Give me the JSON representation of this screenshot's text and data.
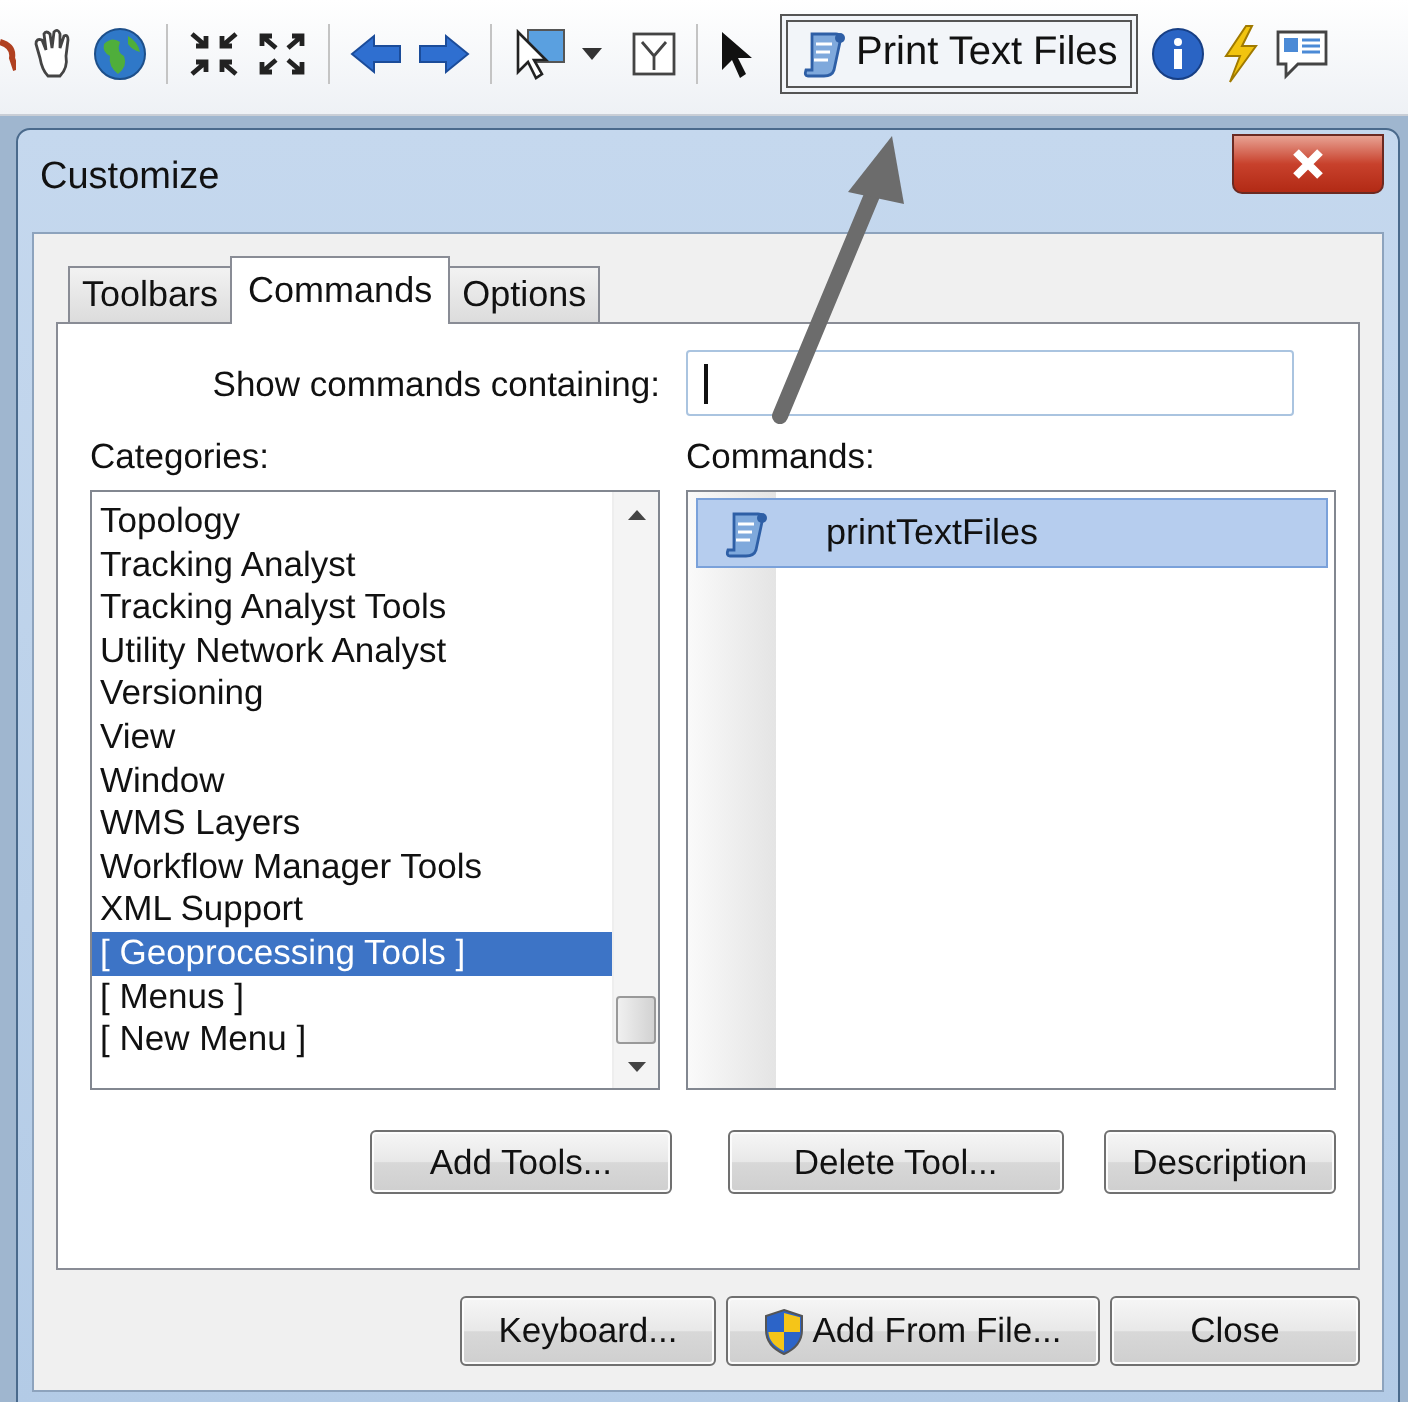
{
  "toolbar": {
    "text_button": {
      "label": "Print Text Files",
      "highlighted": true
    }
  },
  "dialog": {
    "title": "Customize",
    "tabs": [
      {
        "label": "Toolbars",
        "selected": false
      },
      {
        "label": "Commands",
        "selected": true
      },
      {
        "label": "Options",
        "selected": false
      }
    ],
    "filter": {
      "label": "Show commands containing:",
      "focused": true
    },
    "categories": {
      "label": "Categories:",
      "items": [
        {
          "label": "Topology",
          "selected": false
        },
        {
          "label": "Tracking Analyst",
          "selected": false
        },
        {
          "label": "Tracking Analyst Tools",
          "selected": false
        },
        {
          "label": "Utility Network Analyst",
          "selected": false
        },
        {
          "label": "Versioning",
          "selected": false
        },
        {
          "label": "View",
          "selected": false
        },
        {
          "label": "Window",
          "selected": false
        },
        {
          "label": "WMS Layers",
          "selected": false
        },
        {
          "label": "Workflow Manager Tools",
          "selected": false
        },
        {
          "label": "XML Support",
          "selected": false
        },
        {
          "label": "[ Geoprocessing Tools ]",
          "selected": true
        },
        {
          "label": "[ Menus ]",
          "selected": false
        },
        {
          "label": "[ New Menu ]",
          "selected": false
        }
      ]
    },
    "commands": {
      "label": "Commands:",
      "items": [
        {
          "label": "printTextFiles",
          "selected": true
        }
      ]
    },
    "panel_buttons": [
      {
        "label": "Add Tools..."
      },
      {
        "label": "Delete Tool..."
      },
      {
        "label": "Description"
      }
    ],
    "footer_buttons": [
      {
        "label": "Keyboard...",
        "kind": "plain"
      },
      {
        "label": "Add From File...",
        "kind": "shield"
      },
      {
        "label": "Close",
        "kind": "plain"
      }
    ]
  }
}
